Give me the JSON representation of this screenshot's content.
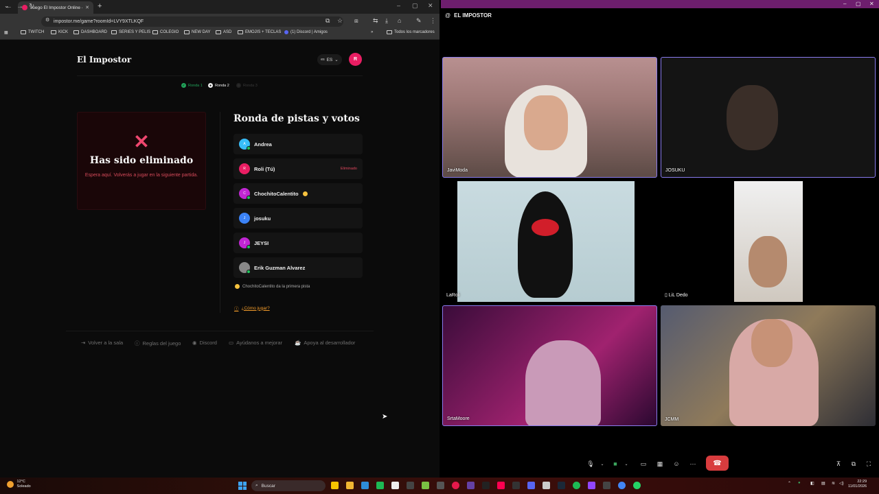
{
  "browser": {
    "tab_title": "Juego El Impostor Online - Jueg",
    "url": "impostor.me/game?roomId=LVY9XTLKQF",
    "bookmarks": [
      "TWITCH",
      "KICK",
      "DASHBOARD",
      "SERIES Y PELIS",
      "COLEGIO",
      "NEW DAY",
      "ASD",
      "EMOJIS + TECLAS",
      "(1) Discord | Amigos"
    ],
    "all_bookmarks": "Todos los marcadores",
    "overflow": "»"
  },
  "game": {
    "brand": "El Impostor",
    "language": "ES",
    "avatar_initial": "R",
    "steps": [
      {
        "label": "Ronda 1",
        "state": "done"
      },
      {
        "label": "Ronda 2",
        "state": "current"
      },
      {
        "label": "Ronda 3",
        "state": "pending"
      }
    ],
    "eliminated_icon": "✕",
    "eliminated_title": "Has sido eliminado",
    "eliminated_sub": "Espera aquí. Volverás a jugar en la siguiente partida.",
    "round_title": "Ronda de pistas y votos",
    "players": [
      {
        "initial": "A",
        "name": "Andrea",
        "color": "#38bdf8",
        "online": true,
        "status": "",
        "coin": false
      },
      {
        "initial": "R",
        "name": "Roli (Tú)",
        "color": "#e91e63",
        "online": false,
        "status": "Eliminado",
        "coin": false
      },
      {
        "initial": "C",
        "name": "ChochitoCalentito",
        "color": "#c026d3",
        "online": true,
        "status": "",
        "coin": true
      },
      {
        "initial": "J",
        "name": "josuku",
        "color": "#3b82f6",
        "online": false,
        "status": "",
        "coin": false
      },
      {
        "initial": "J",
        "name": "JEYSI",
        "color": "#c026d3",
        "online": true,
        "status": "",
        "coin": false
      },
      {
        "initial": "",
        "name": "Erik Guzman Alvarez",
        "color": "#888888",
        "online": true,
        "status": "",
        "coin": false
      }
    ],
    "first_clue_hint": "ChochitoCalentito da la primera pista",
    "how_to_play": "¿Cómo jugar?",
    "footer_links": [
      "Volver a la sala",
      "Reglas del juego",
      "Discord",
      "Ayúdanos a mejorar",
      "Apoya al desarrollador"
    ]
  },
  "discord": {
    "title": "EL IMPOSTOR",
    "participants": [
      "JaviModa",
      "JOSUKU",
      "LaRoli",
      "LiL Dedo",
      "SrtaMoore",
      "JCMM"
    ]
  },
  "taskbar": {
    "temperature": "12°C",
    "weather": "Soleado",
    "search_placeholder": "Buscar",
    "time": "22:29",
    "date": "11/01/2026"
  },
  "colors": {
    "accent": "#e91e63",
    "eliminated": "#ef476f",
    "hangup": "#d83c3e",
    "discord_bar": "#6e1e6e"
  }
}
